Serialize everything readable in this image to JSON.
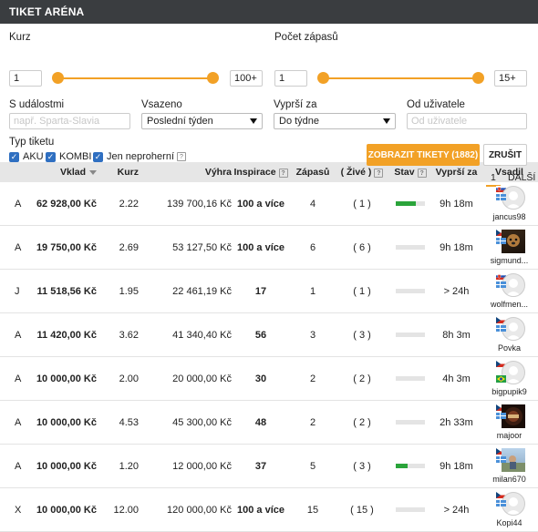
{
  "title": "TIKET ARÉNA",
  "filters": {
    "kurz_label": "Kurz",
    "kurz_min": "1",
    "kurz_max": "100+",
    "pocet_label": "Počet zápasů",
    "pocet_min": "1",
    "pocet_max": "15+",
    "udalost_label": "S událostmi",
    "udalost_placeholder": "např. Sparta-Slavia",
    "vsazeno_label": "Vsazeno",
    "vsazeno_value": "Poslední týden",
    "vyprsi_label": "Vyprší za",
    "vyprsi_value": "Do týdne",
    "uzivatel_label": "Od uživatele",
    "uzivatel_placeholder": "Od uživatele",
    "typ_label": "Typ tiketu",
    "cb_aku": "AKU",
    "cb_kombi": "KOMBI",
    "cb_neproherni": "Jen neproherní"
  },
  "buttons": {
    "show": "ZOBRAZIT TIKETY (1882)",
    "cancel": "ZRUŠIT"
  },
  "pager": {
    "page": "1",
    "next": "DALŠÍ"
  },
  "columns": {
    "vklad": "Vklad",
    "kurz": "Kurz",
    "vyhra": "Výhra",
    "inspirace": "Inspirace",
    "zapasu": "Zápasů",
    "zive": "( Živé )",
    "stav": "Stav",
    "vyprsi": "Vyprší za",
    "vsadil": "Vsadil"
  },
  "colors": {
    "accent": "#f2a126",
    "header": "#3a3d40",
    "checkbox": "#2f6fc1",
    "status_green": "#2aa43a"
  },
  "rows": [
    {
      "type": "A",
      "vklad": "62 928,00 Kč",
      "kurz": "2.22",
      "vyhra": "139 700,16 Kč",
      "inspirace": "100 a více",
      "zapasu": "4",
      "zive": "( 1 )",
      "progress": 0.7,
      "vyprsi": "9h 18m",
      "user": "jancus98",
      "flag": "sk",
      "avatar": "default"
    },
    {
      "type": "A",
      "vklad": "19 750,00 Kč",
      "kurz": "2.69",
      "vyhra": "53 127,50 Kč",
      "inspirace": "100 a více",
      "zapasu": "6",
      "zive": "( 6 )",
      "progress": 0,
      "vyprsi": "9h 18m",
      "user": "sigmund...",
      "flag": "cz",
      "avatar": "dog"
    },
    {
      "type": "J",
      "vklad": "11 518,56 Kč",
      "kurz": "1.95",
      "vyhra": "22 461,19 Kč",
      "inspirace": "17",
      "zapasu": "1",
      "zive": "( 1 )",
      "progress": 0,
      "vyprsi": "> 24h",
      "user": "wolfmen...",
      "flag": "sk",
      "avatar": "default"
    },
    {
      "type": "A",
      "vklad": "11 420,00 Kč",
      "kurz": "3.62",
      "vyhra": "41 340,40 Kč",
      "inspirace": "56",
      "zapasu": "3",
      "zive": "( 3 )",
      "progress": 0,
      "vyprsi": "8h 3m",
      "user": "Povka",
      "flag": "cz",
      "avatar": "default"
    },
    {
      "type": "A",
      "vklad": "10 000,00 Kč",
      "kurz": "2.00",
      "vyhra": "20 000,00 Kč",
      "inspirace": "30",
      "zapasu": "2",
      "zive": "( 2 )",
      "progress": 0,
      "vyprsi": "4h 3m",
      "user": "bigpupik9",
      "flag": "cz-br",
      "avatar": "default"
    },
    {
      "type": "A",
      "vklad": "10 000,00 Kč",
      "kurz": "4.53",
      "vyhra": "45 300,00 Kč",
      "inspirace": "48",
      "zapasu": "2",
      "zive": "( 2 )",
      "progress": 0,
      "vyprsi": "2h 33m",
      "user": "majoor",
      "flag": "cz",
      "avatar": "dark"
    },
    {
      "type": "A",
      "vklad": "10 000,00 Kč",
      "kurz": "1.20",
      "vyhra": "12 000,00 Kč",
      "inspirace": "37",
      "zapasu": "5",
      "zive": "( 3 )",
      "progress": 0.4,
      "vyprsi": "9h 18m",
      "user": "milan670",
      "flag": "cz",
      "avatar": "outdoor"
    },
    {
      "type": "X",
      "vklad": "10 000,00 Kč",
      "kurz": "12.00",
      "vyhra": "120 000,00 Kč",
      "inspirace": "100 a více",
      "zapasu": "15",
      "zive": "( 15 )",
      "progress": 0,
      "vyprsi": "> 24h",
      "user": "Kopi44",
      "flag": "cz",
      "avatar": "default"
    }
  ]
}
